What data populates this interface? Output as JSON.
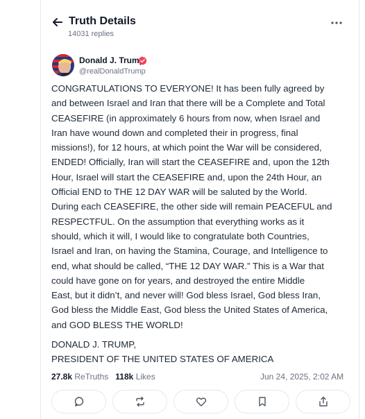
{
  "header": {
    "title": "Truth Details",
    "replies_count": "14031 replies",
    "back_icon": "arrow-left-icon",
    "more_icon": "more-horizontal-icon"
  },
  "post": {
    "author": {
      "name": "Donald J. Trump",
      "handle": "@realDonaldTrump",
      "verified_icon": "verified-badge-icon",
      "verified_color": "#f43f5e"
    },
    "body_lines": [
      "CONGRATULATIONS TO EVERYONE! It has been fully agreed by",
      "and between Israel and Iran that there will be a Complete and Total",
      "CEASEFIRE (in approximately 6 hours from now, when Israel and",
      "Iran have wound down and completed their in progress, final",
      "missions!), for 12 hours, at which point the War will be considered,",
      "ENDED! Officially, Iran will start the CEASEFIRE and, upon the 12th",
      "Hour, Israel will start the CEASEFIRE and, upon the 24th Hour, an",
      "Official END to THE 12 DAY WAR will be saluted by the World.",
      "During each CEASEFIRE, the other side will remain PEACEFUL and",
      "RESPECTFUL. On the assumption that everything works as it",
      "should, which it will, I would like to congratulate both Countries,",
      "Israel and Iran, on having the Stamina, Courage, and Intelligence to",
      "end, what should be called, “THE 12 DAY WAR.” This is a War that",
      "could have gone on for years, and destroyed the entire Middle",
      "East, but it didn’t, and never will! God bless Israel, God bless Iran,",
      "God bless the Middle East, God bless the United States of America,",
      "and GOD BLESS THE WORLD!"
    ],
    "signature_lines": [
      "DONALD J. TRUMP,",
      "PRESIDENT OF THE UNITED STATES OF AMERICA"
    ],
    "stats": {
      "retruths_count": "27.8k",
      "retruths_label": "ReTruths",
      "likes_count": "118k",
      "likes_label": "Likes"
    },
    "timestamp": "Jun 24, 2025, 2:02 AM"
  },
  "actions": [
    {
      "name": "reply",
      "icon": "comment-icon"
    },
    {
      "name": "retruth",
      "icon": "repost-icon"
    },
    {
      "name": "like",
      "icon": "heart-icon"
    },
    {
      "name": "bookmark",
      "icon": "bookmark-icon"
    },
    {
      "name": "share",
      "icon": "share-icon"
    }
  ]
}
